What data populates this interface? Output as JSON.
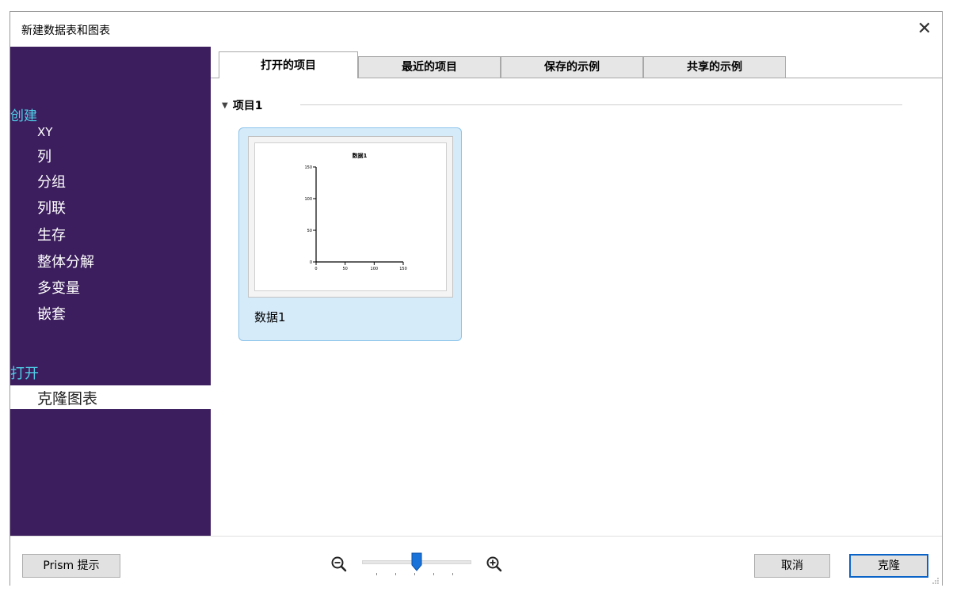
{
  "window": {
    "title": "新建数据表和图表",
    "close_glyph": "✕"
  },
  "sidebar": {
    "create_header": "创建",
    "create_items": [
      "XY",
      "列",
      "分组",
      "列联",
      "生存",
      "整体分解",
      "多变量",
      "嵌套"
    ],
    "open_header": "打开",
    "open_items": [
      "克隆图表"
    ],
    "selected_item": "克隆图表",
    "background": "#3c1e5e",
    "header_color": "#4fd0e8"
  },
  "tabs": [
    "打开的项目",
    "最近的项目",
    "保存的示例",
    "共享的示例"
  ],
  "active_tab": "打开的项目",
  "group": {
    "arrow_glyph": "▼",
    "title": "项目1"
  },
  "card": {
    "label": "数据1",
    "chart_data": {
      "type": "scatter",
      "title": "数据1",
      "x": [],
      "y": [],
      "xlim": [
        0,
        150
      ],
      "ylim": [
        0,
        150
      ],
      "xticks": [
        "0",
        "50",
        "100",
        "150"
      ],
      "yticks": [
        "0",
        "50",
        "100",
        "150"
      ],
      "xlabel": "",
      "ylabel": ""
    }
  },
  "footer": {
    "tips_button": "Prism 提示",
    "zoom_out_icon": "zoom-out-icon",
    "zoom_in_icon": "zoom-in-icon",
    "zoom_level": 0.5,
    "cancel_button": "取消",
    "clone_button": "克隆",
    "accent_color": "#0a64c8"
  }
}
